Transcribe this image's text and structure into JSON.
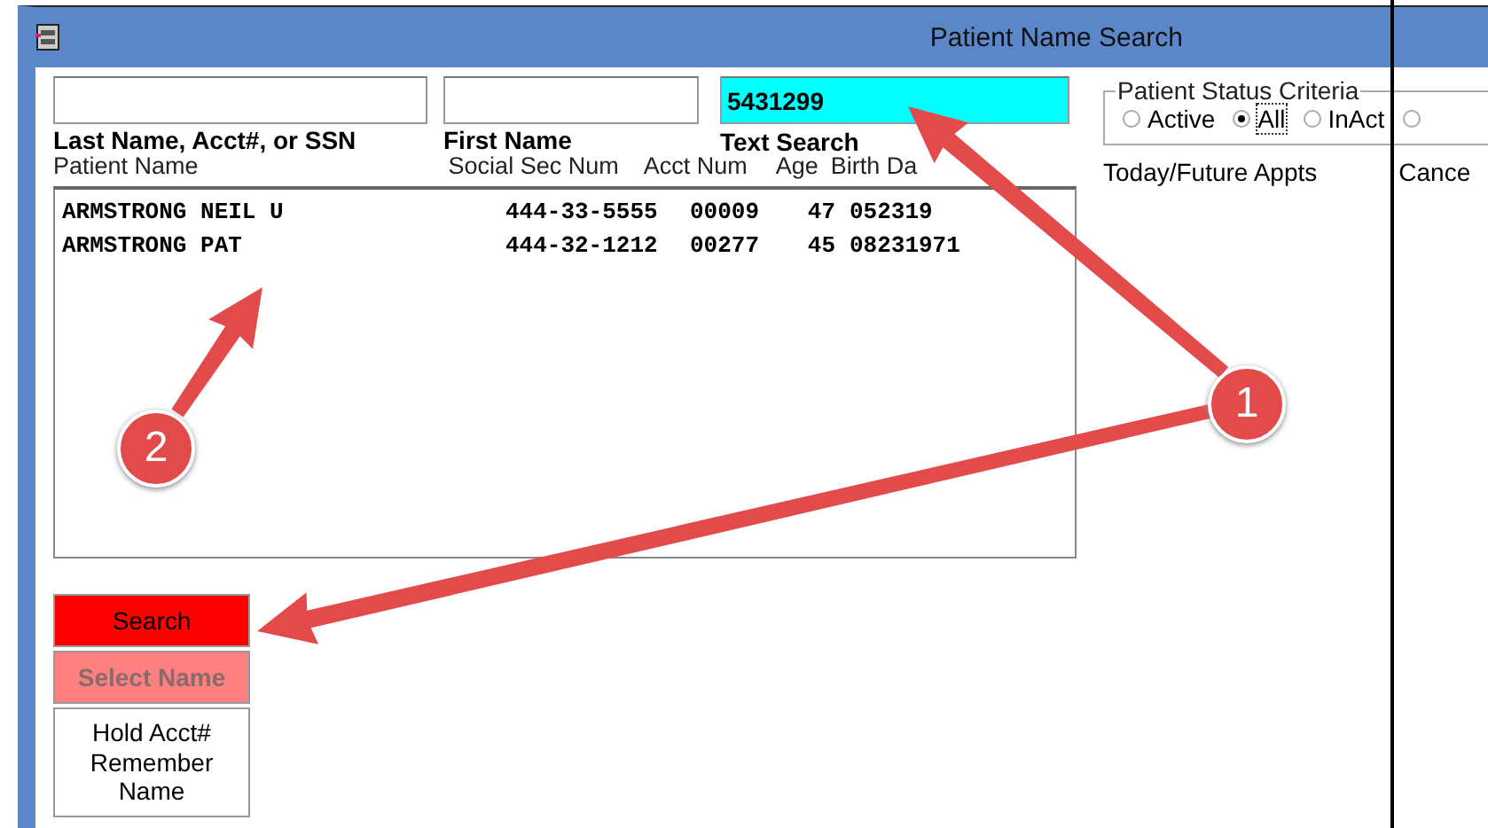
{
  "window": {
    "title": "Patient Name Search"
  },
  "fields": [
    {
      "label": "Last Name, Acct#, or SSN",
      "highlighted": false
    },
    {
      "label": "First Name",
      "highlighted": false
    },
    {
      "label": "Text Search",
      "value": "5431299",
      "highlighted": true
    }
  ],
  "table": {
    "columns": [
      "Patient Name",
      "Social Sec Num",
      "Acct Num",
      "Age",
      "Birth Da"
    ],
    "rows": [
      [
        "ARMSTRONG NEIL U",
        "444-33-5555",
        "00009",
        "47",
        "052319"
      ],
      [
        "ARMSTRONG PAT",
        "444-32-1212",
        "00277",
        "45",
        "08231971"
      ]
    ]
  },
  "status_criteria": {
    "title": "Patient Status Criteria",
    "options": [
      {
        "label": "Active",
        "selected": false
      },
      {
        "label": "All",
        "selected": true
      },
      {
        "label": "InAct",
        "selected": false
      },
      {
        "selected": false
      }
    ]
  },
  "appt_labels": [
    "Today/Future Appts",
    "Cance"
  ],
  "buttons": [
    {
      "label": "Search",
      "kind": "primary"
    },
    {
      "label": "Select Name",
      "kind": "disabled"
    },
    {
      "label": "Hold Acct# Remember Name",
      "kind": "plain"
    }
  ],
  "annotations": [
    {
      "number": "1"
    },
    {
      "number": "2"
    }
  ]
}
